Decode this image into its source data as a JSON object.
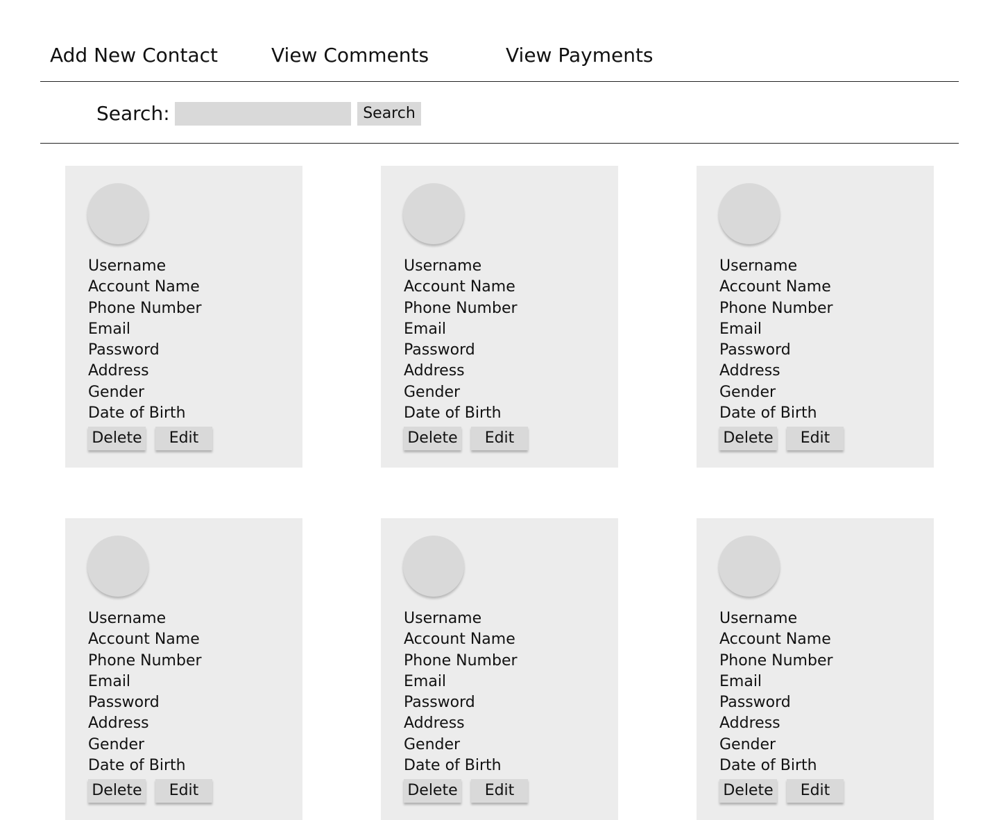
{
  "nav": {
    "add_contact": "Add New Contact",
    "view_comments": "View Comments",
    "view_payments": "View Payments"
  },
  "search": {
    "label": "Search:",
    "value": "",
    "button": "Search"
  },
  "contacts": [
    {
      "fields": [
        "Username",
        "Account Name",
        "Phone Number",
        "Email",
        "Password",
        "Address",
        "Gender",
        "Date of Birth"
      ],
      "delete_label": "Delete",
      "edit_label": "Edit"
    },
    {
      "fields": [
        "Username",
        "Account Name",
        "Phone Number",
        "Email",
        "Password",
        "Address",
        "Gender",
        "Date of Birth"
      ],
      "delete_label": "Delete",
      "edit_label": "Edit"
    },
    {
      "fields": [
        "Username",
        "Account Name",
        "Phone Number",
        "Email",
        "Password",
        "Address",
        "Gender",
        "Date of Birth"
      ],
      "delete_label": "Delete",
      "edit_label": "Edit"
    },
    {
      "fields": [
        "Username",
        "Account Name",
        "Phone Number",
        "Email",
        "Password",
        "Address",
        "Gender",
        "Date of Birth"
      ],
      "delete_label": "Delete",
      "edit_label": "Edit"
    },
    {
      "fields": [
        "Username",
        "Account Name",
        "Phone Number",
        "Email",
        "Password",
        "Address",
        "Gender",
        "Date of Birth"
      ],
      "delete_label": "Delete",
      "edit_label": "Edit"
    },
    {
      "fields": [
        "Username",
        "Account Name",
        "Phone Number",
        "Email",
        "Password",
        "Address",
        "Gender",
        "Date of Birth"
      ],
      "delete_label": "Delete",
      "edit_label": "Edit"
    }
  ],
  "colors": {
    "card_background": "#ececec",
    "control_background": "#d9d9d9",
    "divider": "#222222"
  }
}
